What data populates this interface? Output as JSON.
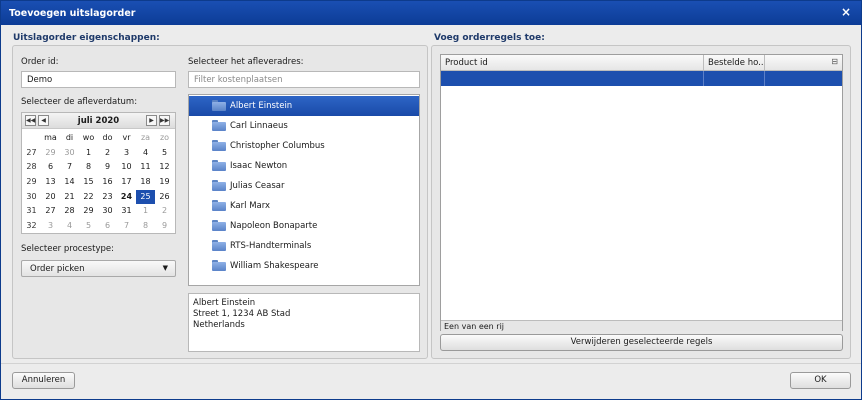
{
  "window": {
    "title": "Toevoegen uitslagorder",
    "close_glyph": "×"
  },
  "left_section": {
    "title": "Uitslagorder eigenschappen:",
    "order_id_label": "Order id:",
    "order_id_value": "Demo",
    "date_label": "Selecteer de afleverdatum:",
    "process_label": "Selecteer procestype:",
    "process_value": "Order picken"
  },
  "calendar": {
    "month_label": "juli 2020",
    "prev_year": "◀◀",
    "prev_month": "◀",
    "next_month": "▶",
    "next_year": "▶▶",
    "weekdays": [
      "ma",
      "di",
      "wo",
      "do",
      "vr",
      "za",
      "zo"
    ],
    "weeks": [
      {
        "wk": "27",
        "days": [
          {
            "d": "29",
            "o": true
          },
          {
            "d": "30",
            "o": true
          },
          {
            "d": "1"
          },
          {
            "d": "2"
          },
          {
            "d": "3"
          },
          {
            "d": "4"
          },
          {
            "d": "5"
          }
        ]
      },
      {
        "wk": "28",
        "days": [
          {
            "d": "6"
          },
          {
            "d": "7"
          },
          {
            "d": "8"
          },
          {
            "d": "9"
          },
          {
            "d": "10"
          },
          {
            "d": "11"
          },
          {
            "d": "12"
          }
        ]
      },
      {
        "wk": "29",
        "days": [
          {
            "d": "13"
          },
          {
            "d": "14"
          },
          {
            "d": "15"
          },
          {
            "d": "16"
          },
          {
            "d": "17"
          },
          {
            "d": "18"
          },
          {
            "d": "19"
          }
        ]
      },
      {
        "wk": "30",
        "days": [
          {
            "d": "20"
          },
          {
            "d": "21"
          },
          {
            "d": "22"
          },
          {
            "d": "23"
          },
          {
            "d": "24",
            "t": true
          },
          {
            "d": "25",
            "s": true
          },
          {
            "d": "26"
          }
        ]
      },
      {
        "wk": "31",
        "days": [
          {
            "d": "27"
          },
          {
            "d": "28"
          },
          {
            "d": "29"
          },
          {
            "d": "30"
          },
          {
            "d": "31"
          },
          {
            "d": "1",
            "o": true
          },
          {
            "d": "2",
            "o": true
          }
        ]
      },
      {
        "wk": "32",
        "days": [
          {
            "d": "3",
            "o": true
          },
          {
            "d": "4",
            "o": true
          },
          {
            "d": "5",
            "o": true
          },
          {
            "d": "6",
            "o": true
          },
          {
            "d": "7",
            "o": true
          },
          {
            "d": "8",
            "o": true
          },
          {
            "d": "9",
            "o": true
          }
        ]
      }
    ]
  },
  "address": {
    "label": "Selecteer het afleveradres:",
    "filter_placeholder": "Filter kostenplaatsen",
    "items": [
      {
        "name": "Albert Einstein",
        "selected": true
      },
      {
        "name": "Carl Linnaeus"
      },
      {
        "name": "Christopher Columbus"
      },
      {
        "name": "Isaac Newton"
      },
      {
        "name": "Julias Ceasar"
      },
      {
        "name": "Karl Marx"
      },
      {
        "name": "Napoleon Bonaparte"
      },
      {
        "name": "RTS-Handterminals"
      },
      {
        "name": "William Shakespeare"
      }
    ],
    "detail_lines": [
      "Albert Einstein",
      "Street 1, 1234 AB Stad",
      "Netherlands"
    ]
  },
  "right_section": {
    "title": "Voeg orderregels toe:",
    "columns": [
      "Product id",
      "Bestelde ho..."
    ],
    "footer_text": "Een van een rij",
    "remove_button": "Verwijderen geselecteerde regels"
  },
  "footer": {
    "cancel_label": "Annuleren",
    "ok_label": "OK"
  },
  "colors": {
    "title_bar": "#0c3c96",
    "selection": "#1d4fae"
  }
}
